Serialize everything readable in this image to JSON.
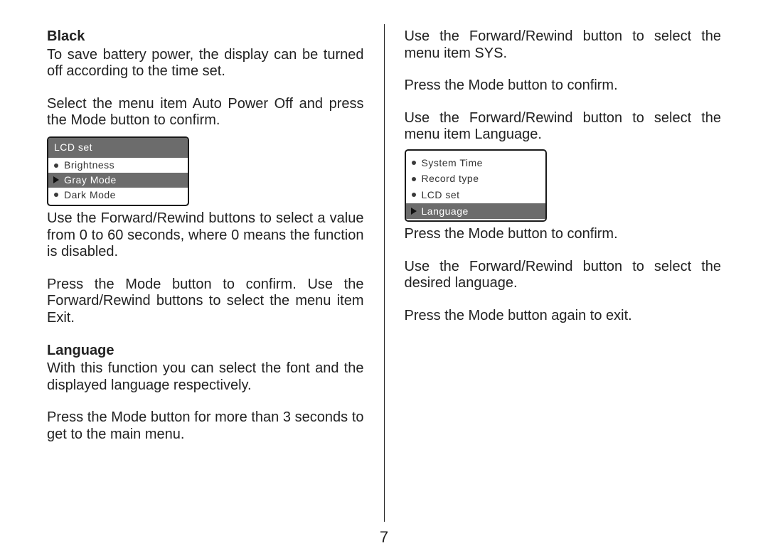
{
  "pageNumber": "7",
  "left": {
    "heading1": "Black",
    "p1": "To save battery power, the display can be turned off according to the time set.",
    "p2": "Select the menu item Auto Power Off and press the Mode button to confirm.",
    "lcd": {
      "title": "LCD set",
      "items": [
        {
          "label": "Brightness",
          "selected": false
        },
        {
          "label": "Gray  Mode",
          "selected": true
        },
        {
          "label": "Dark Mode",
          "selected": false
        }
      ]
    },
    "p3": "Use the Forward/Rewind buttons to select a value from 0 to 60 seconds, where 0 means the function is disabled.",
    "p4": "Press the Mode button to confirm. Use the Forward/Rewind buttons to select the menu item Exit.",
    "heading2": "Language",
    "p5": "With this function you can select the font and the displayed language respectively.",
    "p6": "Press the Mode button for more than 3 seconds to get to the main menu."
  },
  "right": {
    "p1": "Use the Forward/Rewind button to select the menu item SYS.",
    "p2": "Press the Mode button to confirm.",
    "p3": "Use the Forward/Rewind button to select the menu item Language.",
    "sys": {
      "items": [
        {
          "label": "System Time",
          "selected": false
        },
        {
          "label": "Record type",
          "selected": false
        },
        {
          "label": "LCD set",
          "selected": false
        },
        {
          "label": "Language",
          "selected": true
        }
      ]
    },
    "p4": "Press the Mode button to confirm.",
    "p5": "Use the Forward/Rewind button to select the desired language.",
    "p6": "Press the Mode button again to exit."
  }
}
